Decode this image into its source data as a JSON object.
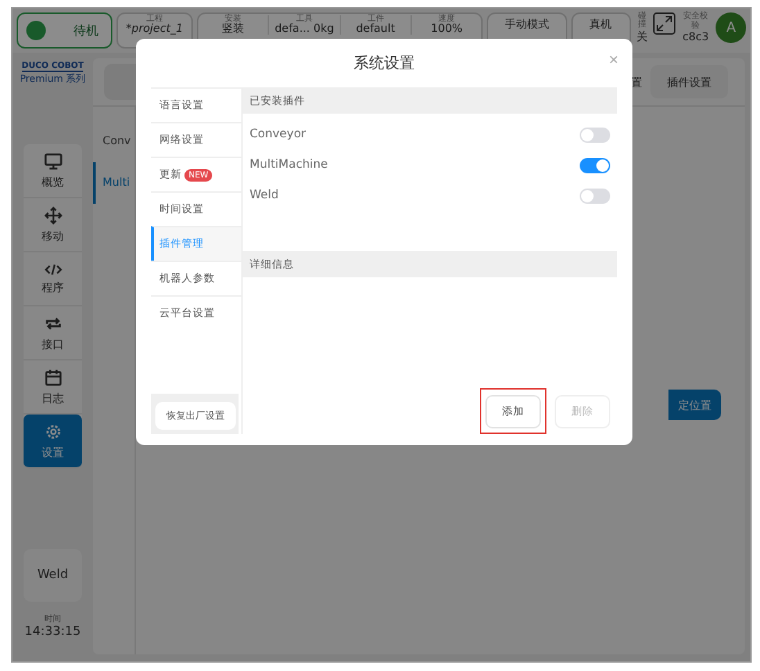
{
  "status_bar": {
    "state": "待机",
    "project": {
      "label": "工程",
      "value": "*project_1"
    },
    "fields": [
      {
        "label": "安装",
        "value": "竖装"
      },
      {
        "label": "工具",
        "value": "defa...   0kg"
      },
      {
        "label": "工件",
        "value": "default"
      },
      {
        "label": "速度",
        "value": "100%"
      }
    ],
    "mode": "手动模式",
    "machine": "真机",
    "collision": {
      "label": "碰撞",
      "value": "关"
    },
    "safety": {
      "label": "安全校验",
      "value": "c8c3"
    },
    "avatar": "A"
  },
  "logo": {
    "name": "DUCO COBOT",
    "series": "Premium 系列"
  },
  "nav": [
    {
      "label": "概览",
      "selected": false
    },
    {
      "label": "移动",
      "selected": false
    },
    {
      "label": "程序",
      "selected": false
    },
    {
      "label": "接口",
      "selected": false
    },
    {
      "label": "日志",
      "selected": false
    },
    {
      "label": "设置",
      "selected": true
    }
  ],
  "plugin_shortcut": "Weld",
  "clock": {
    "label": "时间",
    "value": "14:33:15"
  },
  "main": {
    "header_button_partial": "置",
    "plugin_settings_button": "插件设置",
    "plugins": [
      {
        "name": "Conv",
        "selected": false
      },
      {
        "name": "Multi",
        "selected": true
      }
    ],
    "action_button_partial": "定位置"
  },
  "dialog": {
    "title": "系统设置",
    "close": "×",
    "menu": [
      {
        "label": "语言设置",
        "selected": false
      },
      {
        "label": "网络设置",
        "selected": false
      },
      {
        "label": "更新",
        "badge": "NEW",
        "selected": false
      },
      {
        "label": "时间设置",
        "selected": false
      },
      {
        "label": "插件管理",
        "selected": true
      },
      {
        "label": "机器人参数",
        "selected": false
      },
      {
        "label": "云平台设置",
        "selected": false
      }
    ],
    "restore_button": "恢复出厂设置",
    "installed_header": "已安装插件",
    "plugins": [
      {
        "name": "Conveyor",
        "on": false
      },
      {
        "name": "MultiMachine",
        "on": true
      },
      {
        "name": "Weld",
        "on": false
      }
    ],
    "details_header": "详细信息",
    "buttons": [
      {
        "label": "添加",
        "disabled": false,
        "highlighted": true
      },
      {
        "label": "删除",
        "disabled": true,
        "highlighted": false
      }
    ]
  }
}
